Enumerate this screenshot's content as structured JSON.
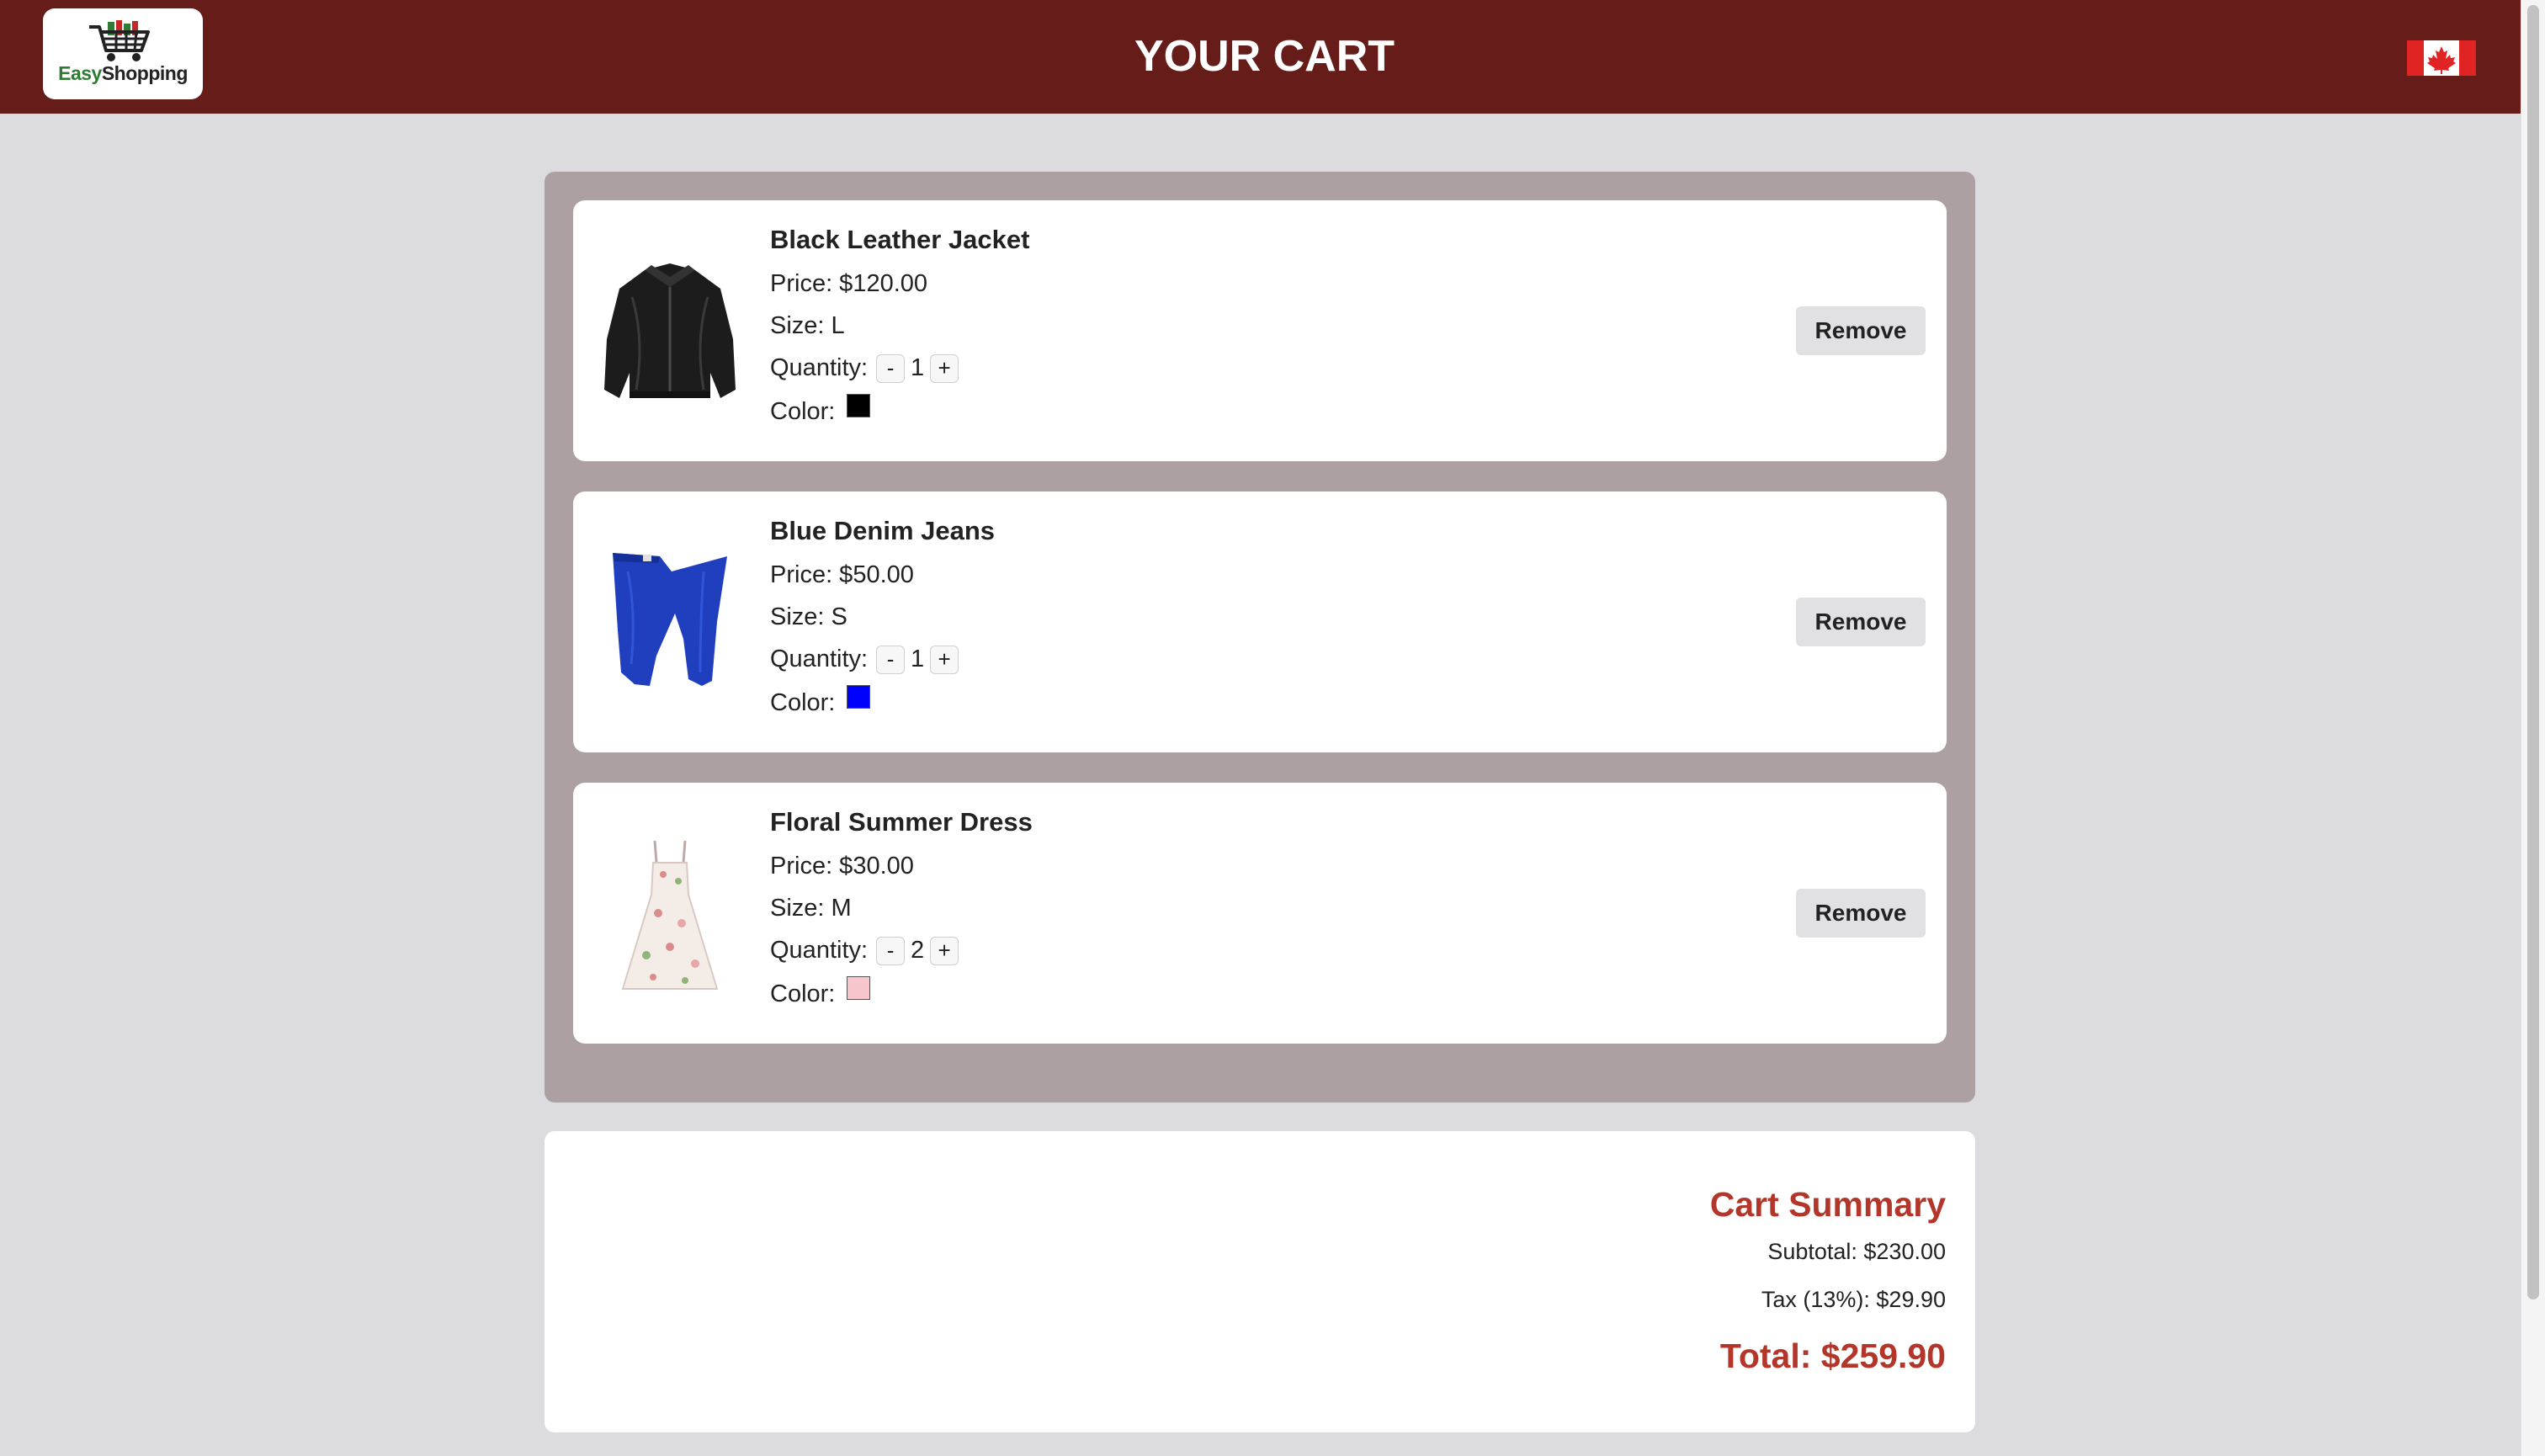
{
  "header": {
    "logo_text_easy": "Easy",
    "logo_text_shopping": "Shopping",
    "title": "YOUR CART",
    "flag_icon": "canada-flag-icon"
  },
  "labels": {
    "price": "Price: ",
    "size": "Size: ",
    "quantity": "Quantity: ",
    "color": "Color: ",
    "minus": "-",
    "plus": "+",
    "remove": "Remove"
  },
  "items": [
    {
      "name": "Black Leather Jacket",
      "price_text": "Price: $120.00",
      "size_text": "Size: L",
      "quantity": "1",
      "color_hex": "#000000",
      "image_icon": "leather-jacket-image"
    },
    {
      "name": "Blue Denim Jeans",
      "price_text": "Price: $50.00",
      "size_text": "Size: S",
      "quantity": "1",
      "color_hex": "#0000ff",
      "image_icon": "denim-jeans-image"
    },
    {
      "name": "Floral Summer Dress",
      "price_text": "Price: $30.00",
      "size_text": "Size: M",
      "quantity": "2",
      "color_hex": "#f7c6cd",
      "image_icon": "floral-dress-image"
    }
  ],
  "summary": {
    "title": "Cart Summary",
    "subtotal": "Subtotal: $230.00",
    "tax": "Tax (13%): $29.90",
    "total": "Total: $259.90"
  },
  "colors": {
    "header_bg": "#661d1a",
    "accent": "#b3362b",
    "panel_bg": "#ada0a2",
    "page_bg": "#dcdbe0"
  }
}
